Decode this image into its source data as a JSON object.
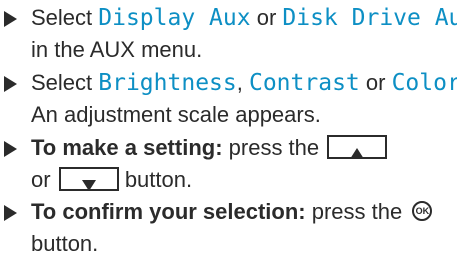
{
  "steps": [
    {
      "pre": "Select ",
      "opt1": "Display Aux",
      "mid": " or ",
      "opt2": "Disk Drive Aux",
      "line2": "in the AUX menu."
    },
    {
      "pre": "Select ",
      "opt1": "Brightness",
      "sep1": ", ",
      "opt2": "Contrast",
      "sep2": " or ",
      "opt3": "Color",
      "end": ".",
      "line2": "An adjustment scale appears."
    },
    {
      "bold": "To make a setting:",
      "text": " press the",
      "line2_pre": "or",
      "line2_post": "button."
    },
    {
      "bold": "To confirm your selection:",
      "text": " press the",
      "ok_label": "OK",
      "line2": "button."
    }
  ],
  "icons": {
    "bullet": "right-triangle-bullet",
    "up_key": "up-arrow-key-icon",
    "down_key": "down-arrow-key-icon",
    "ok": "ok-circle-icon"
  },
  "colors": {
    "text": "#2b2b2b",
    "display_text": "#0d8fc4"
  }
}
